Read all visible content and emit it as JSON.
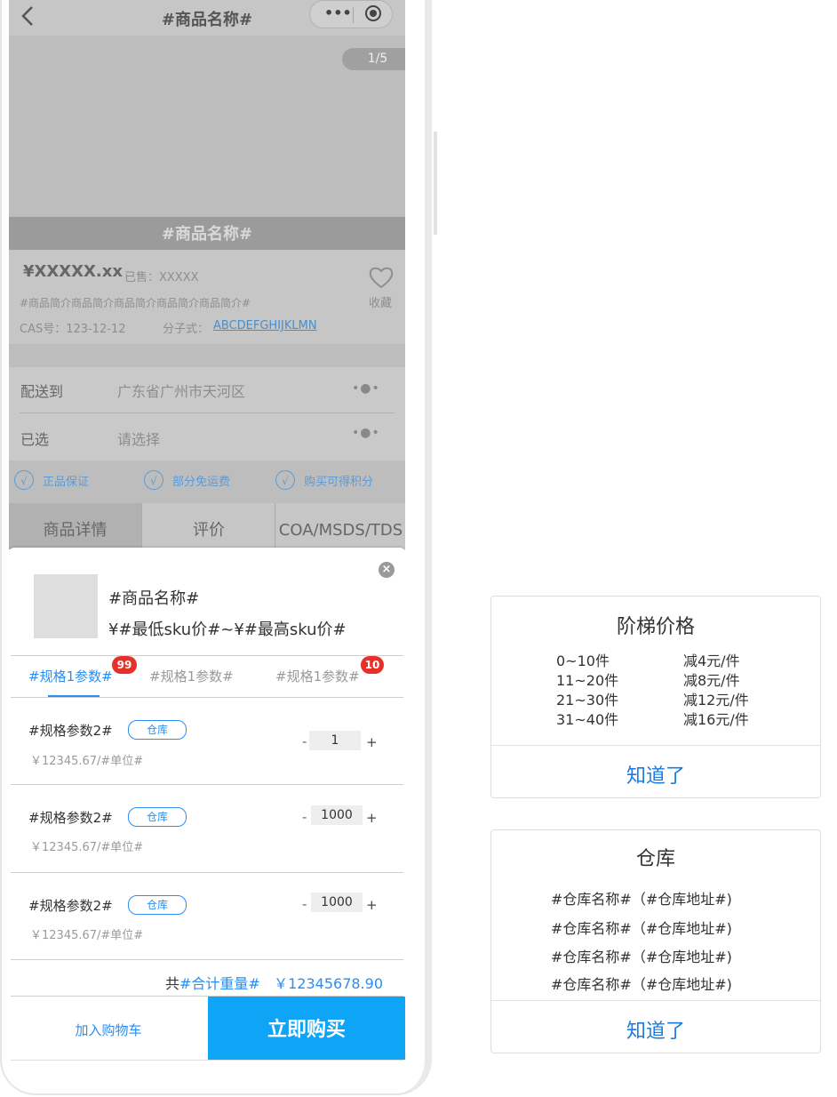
{
  "nav": {
    "back_icon": "chevron-left-icon",
    "title": "#商品名称#",
    "capsule_menu": "•••",
    "capsule_close_icon": "target-icon"
  },
  "gallery": {
    "counter": "1/5",
    "caption": "#商品名称#"
  },
  "product": {
    "price": "¥XXXXX.xx",
    "sold": "已售：XXXXX",
    "intro": "#商品简介商品简介商品简介商品简介商品简介#",
    "cas": "CAS号：123-12-12",
    "formula_label": "分子式：",
    "formula_value": "ABCDEFGHIJKLMN",
    "favorite_label": "收藏"
  },
  "rows": [
    {
      "label": "配送到",
      "value": "广东省广州市天河区",
      "more": "•●•"
    },
    {
      "label": "已选",
      "value": "请选择",
      "more": "•●•"
    }
  ],
  "guarantees": [
    {
      "check": "√",
      "label": "正品保证"
    },
    {
      "check": "√",
      "label": "部分免运费"
    },
    {
      "check": "√",
      "label": "购买可得积分"
    }
  ],
  "tabs": [
    "商品详情",
    "评价",
    "COA/MSDS/TDS"
  ],
  "sheet": {
    "close": "×",
    "name": "#商品名称#",
    "price_range": "¥#最低sku价#~¥#最高sku价#",
    "spec_tabs": [
      {
        "label": "#规格1参数#",
        "badge": "99"
      },
      {
        "label": "#规格1参数#",
        "badge": ""
      },
      {
        "label": "#规格1参数#",
        "badge": "10"
      }
    ],
    "items": [
      {
        "name": "#规格参数2#",
        "tag": "仓库",
        "price": "￥12345.67/#单位#",
        "minus": "-",
        "qty": "1",
        "plus": "+"
      },
      {
        "name": "#规格参数2#",
        "tag": "仓库",
        "price": "￥12345.67/#单位#",
        "minus": "-",
        "qty": "1000",
        "plus": "+"
      },
      {
        "name": "#规格参数2#",
        "tag": "仓库",
        "price": "￥12345.67/#单位#",
        "minus": "-",
        "qty": "1000",
        "plus": "+"
      }
    ],
    "total_prefix": "共",
    "total_weight": "#合计重量#",
    "total_price": "￥12345678.90",
    "add_to_cart": "加入购物车",
    "buy_now": "立即购买"
  },
  "tier_card": {
    "title": "阶梯价格",
    "tiers": [
      {
        "range": "0~10件",
        "discount": "减4元/件"
      },
      {
        "range": "11~20件",
        "discount": "减8元/件"
      },
      {
        "range": "21~30件",
        "discount": "减12元/件"
      },
      {
        "range": "31~40件",
        "discount": "减16元/件"
      }
    ],
    "button": "知道了"
  },
  "warehouse_card": {
    "title": "仓库",
    "lines": [
      "#仓库名称#（#仓库地址#)",
      "#仓库名称#（#仓库地址#)",
      "#仓库名称#（#仓库地址#)",
      "#仓库名称#（#仓库地址#)"
    ],
    "button": "知道了"
  },
  "colors": {
    "accent": "#2a8ef0",
    "buy_button": "#0ea5f7",
    "badge": "#e7302a"
  }
}
